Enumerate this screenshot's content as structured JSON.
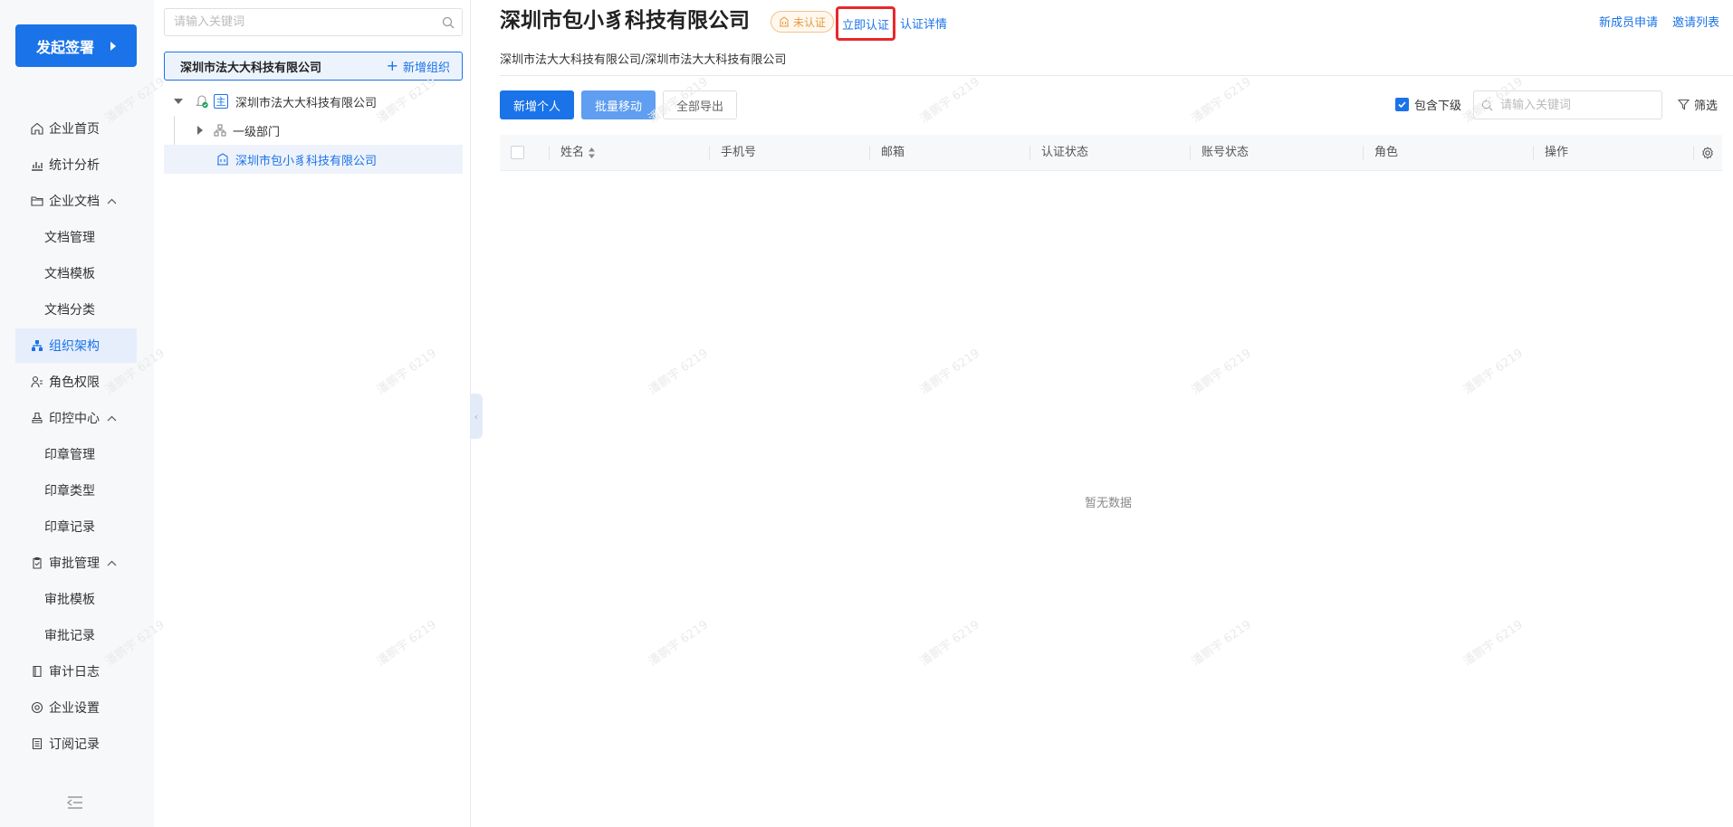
{
  "nav": {
    "start_button": "发起签署",
    "items": [
      {
        "label": "企业首页",
        "icon": "home-icon",
        "level": "top"
      },
      {
        "label": "统计分析",
        "icon": "chart-icon",
        "level": "top"
      },
      {
        "label": "企业文档",
        "icon": "folder-icon",
        "level": "top",
        "expanded": true
      },
      {
        "label": "文档管理",
        "level": "sub"
      },
      {
        "label": "文档模板",
        "level": "sub"
      },
      {
        "label": "文档分类",
        "level": "sub"
      },
      {
        "label": "组织架构",
        "icon": "org-chart-icon",
        "level": "top",
        "active": true
      },
      {
        "label": "角色权限",
        "icon": "user-role-icon",
        "level": "top"
      },
      {
        "label": "印控中心",
        "icon": "stamp-icon",
        "level": "top",
        "expanded": true
      },
      {
        "label": "印章管理",
        "level": "sub"
      },
      {
        "label": "印章类型",
        "level": "sub"
      },
      {
        "label": "印章记录",
        "level": "sub"
      },
      {
        "label": "审批管理",
        "icon": "clipboard-icon",
        "level": "top",
        "expanded": true
      },
      {
        "label": "审批模板",
        "level": "sub"
      },
      {
        "label": "审批记录",
        "level": "sub"
      },
      {
        "label": "审计日志",
        "icon": "log-book-icon",
        "level": "top"
      },
      {
        "label": "企业设置",
        "icon": "settings-icon",
        "level": "top"
      },
      {
        "label": "订阅记录",
        "icon": "list-doc-icon",
        "level": "top"
      }
    ]
  },
  "tree": {
    "search_placeholder": "请输入关键词",
    "org_name": "深圳市法大大科技有限公司",
    "add_org": "新增组织",
    "main_badge": "主",
    "nodes": {
      "root": "深圳市法大大科技有限公司",
      "dept": "一级部门",
      "selected": "深圳市包小豸科技有限公司"
    }
  },
  "main": {
    "title": "深圳市包小豸科技有限公司",
    "cert_status": "未认证",
    "certify_now": "立即认证",
    "cert_detail": "认证详情",
    "new_member_apply": "新成员申请",
    "invite_list": "邀请列表",
    "breadcrumb": "深圳市法大大科技有限公司/深圳市法大大科技有限公司",
    "buttons": {
      "add_person": "新增个人",
      "batch_move": "批量移动",
      "export_all": "全部导出"
    },
    "include_sub": "包含下级",
    "search_placeholder": "请输入关键词",
    "filter": "筛选",
    "columns": [
      "姓名",
      "手机号",
      "邮箱",
      "认证状态",
      "账号状态",
      "角色",
      "操作"
    ],
    "empty": "暂无数据"
  },
  "watermark": "潘鹏宇 6219",
  "colors": {
    "primary": "#1a73e8",
    "highlight_box": "#e8282b",
    "warning": "#e69a3c"
  }
}
